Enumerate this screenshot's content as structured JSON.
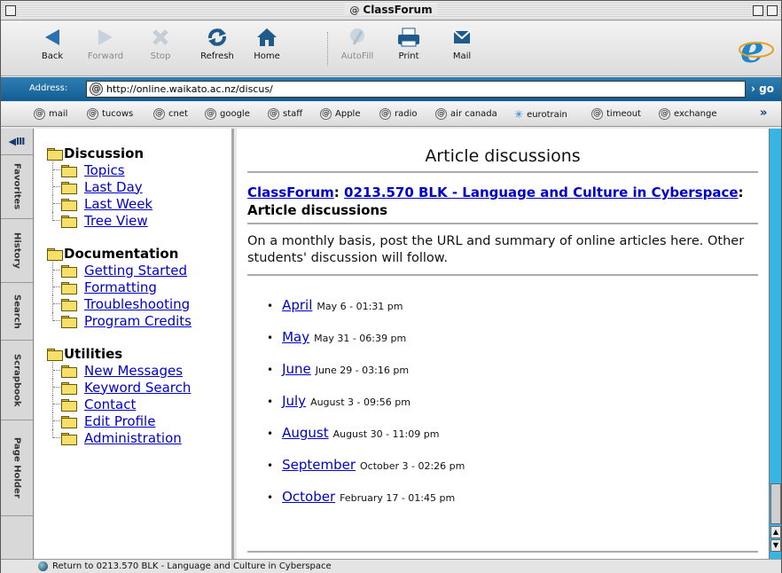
{
  "window": {
    "title": "ClassForum"
  },
  "toolbar": {
    "back": "Back",
    "forward": "Forward",
    "stop": "Stop",
    "refresh": "Refresh",
    "home": "Home",
    "autofill": "AutoFill",
    "print": "Print",
    "mail": "Mail"
  },
  "address": {
    "label": "Address:",
    "url": "http://online.waikato.ac.nz/discus/",
    "go": "go"
  },
  "favorites": [
    "mail",
    "tucows",
    "cnet",
    "google",
    "staff",
    "Apple",
    "radio",
    "air canada",
    "eurotrain",
    "timeout",
    "exchange"
  ],
  "side_tabs": [
    "Favorites",
    "History",
    "Search",
    "Scrapbook",
    "Page Holder"
  ],
  "nav": {
    "discussion": {
      "title": "Discussion",
      "items": [
        "Topics",
        "Last Day",
        "Last Week",
        "Tree View"
      ]
    },
    "documentation": {
      "title": "Documentation",
      "items": [
        "Getting Started",
        "Formatting",
        "Troubleshooting",
        "Program Credits"
      ]
    },
    "utilities": {
      "title": "Utilities",
      "items": [
        "New Messages",
        "Keyword Search",
        "Contact",
        "Edit Profile",
        "Administration"
      ]
    }
  },
  "main": {
    "heading": "Article discussions",
    "crumb_root": "ClassForum",
    "crumb_sep": ":",
    "crumb_topic": "0213.570 BLK - Language and Culture in Cyberspace",
    "crumb_sep2": ":",
    "crumb_current": "Article discussions",
    "description": "On a monthly basis, post the URL and summary of online articles here. Other students' discussion will follow.",
    "months": [
      {
        "name": "April",
        "date": "May 6 - 01:31 pm"
      },
      {
        "name": "May",
        "date": "May 31 - 06:39 pm"
      },
      {
        "name": "June",
        "date": "June 29 - 03:16 pm"
      },
      {
        "name": "July",
        "date": "August 3 - 09:56 pm"
      },
      {
        "name": "August",
        "date": "August 30 - 11:09 pm"
      },
      {
        "name": "September",
        "date": "October 3 - 02:26 pm"
      },
      {
        "name": "October",
        "date": "February 17 - 01:45 pm"
      }
    ]
  },
  "status": {
    "text": "Return to 0213.570 BLK - Language and Culture in Cyberspace"
  },
  "colors": {
    "link": "#0000cc",
    "address_bar": "#1d6ea6",
    "scrollbar": "#38b6e3"
  }
}
